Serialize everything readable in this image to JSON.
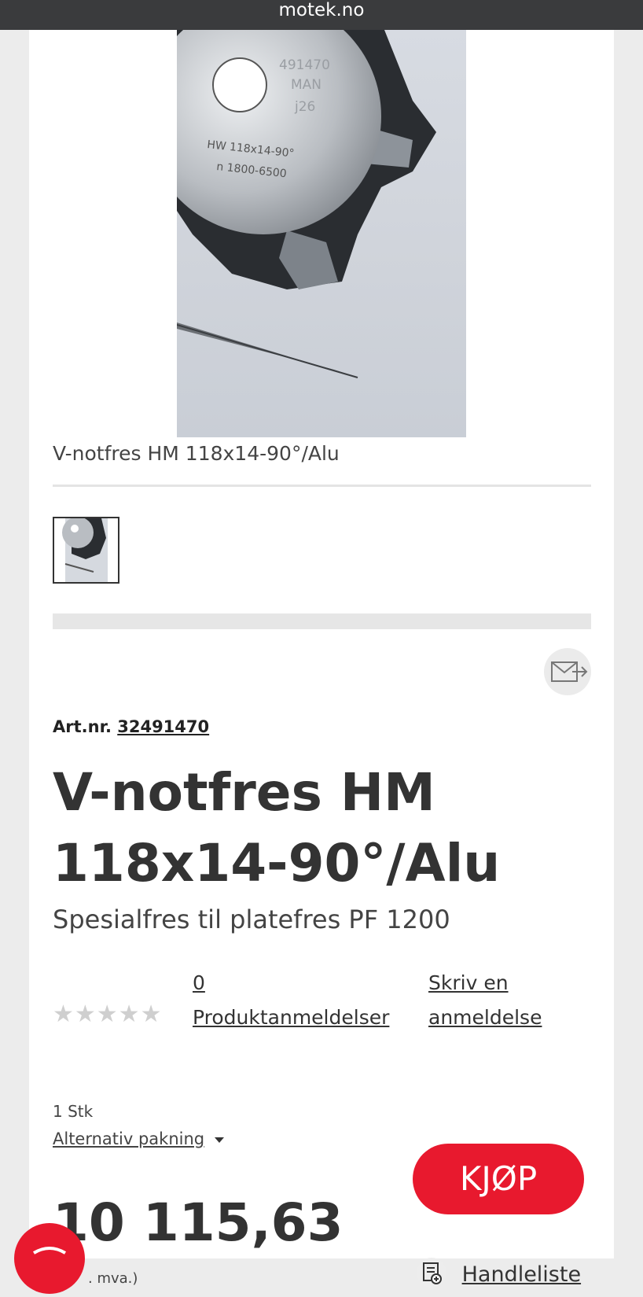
{
  "browser": {
    "domain": "motek.no"
  },
  "product": {
    "caption": "V-notfres HM 118x14-90°/Alu",
    "image_text": [
      "491470",
      "MAN",
      "j26",
      "HW 118x14-90°",
      "n 1800-6500"
    ],
    "art_label": "Art.nr.",
    "art_number": "32491470",
    "title": "V-notfres HM 118x14-90°/Alu",
    "subtitle": "Spesialfres til platefres PF 1200",
    "stars": "★★★★★",
    "rating_value": 0,
    "reviews_count": "0",
    "reviews_label": " Produktanmeldelser",
    "write_review_line1": "Skriv en",
    "write_review_line2": "anmeldelse",
    "unit": "1 Stk",
    "alt_packaging": "Alternativ pakning",
    "price": "10 115,63",
    "vat_note": ". mva.)",
    "buy_label": "KJØP",
    "shopping_list": "Handleliste"
  },
  "colors": {
    "accent": "#e8192e",
    "topbar": "#3a3b3d",
    "page_bg": "#ececec"
  },
  "icons": {
    "share": "envelope-share-icon",
    "dropdown": "caret-down-icon",
    "shopping_list": "list-add-icon",
    "chat": "chat-icon"
  }
}
